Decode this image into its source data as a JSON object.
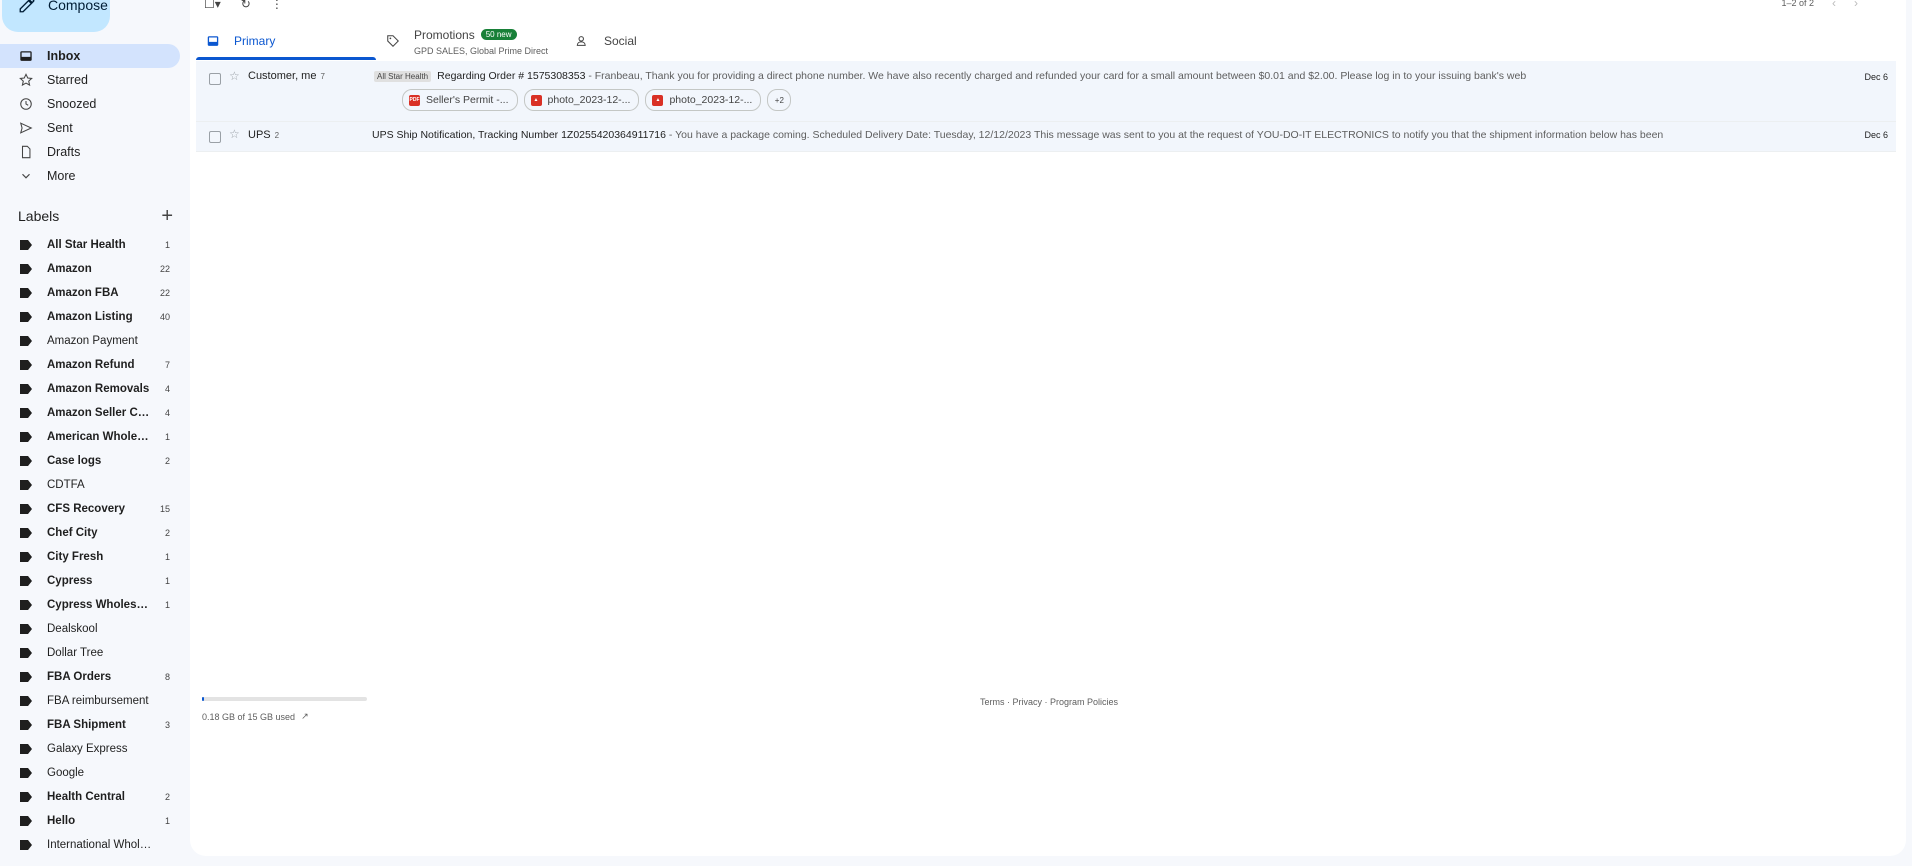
{
  "compose": {
    "label": "Compose"
  },
  "nav": [
    {
      "label": "Inbox",
      "icon": "inbox-icon",
      "active": true
    },
    {
      "label": "Starred",
      "icon": "star-icon"
    },
    {
      "label": "Snoozed",
      "icon": "clock-icon"
    },
    {
      "label": "Sent",
      "icon": "send-icon"
    },
    {
      "label": "Drafts",
      "icon": "draft-icon"
    },
    {
      "label": "More",
      "icon": "chevron-down-icon"
    }
  ],
  "labels_header": "Labels",
  "labels": [
    {
      "name": "All Star Health",
      "count": "1",
      "bold": true
    },
    {
      "name": "Amazon",
      "count": "22",
      "bold": true
    },
    {
      "name": "Amazon FBA",
      "count": "22",
      "bold": true
    },
    {
      "name": "Amazon Listing",
      "count": "40",
      "bold": true
    },
    {
      "name": "Amazon Payment",
      "count": "",
      "bold": false
    },
    {
      "name": "Amazon Refund",
      "count": "7",
      "bold": true
    },
    {
      "name": "Amazon Removals",
      "count": "4",
      "bold": true
    },
    {
      "name": "Amazon Seller Cen...",
      "count": "4",
      "bold": true
    },
    {
      "name": "American Wholesal...",
      "count": "1",
      "bold": true
    },
    {
      "name": "Case logs",
      "count": "2",
      "bold": true
    },
    {
      "name": "CDTFA",
      "count": "",
      "bold": false
    },
    {
      "name": "CFS Recovery",
      "count": "15",
      "bold": true
    },
    {
      "name": "Chef City",
      "count": "2",
      "bold": true
    },
    {
      "name": "City Fresh",
      "count": "1",
      "bold": true
    },
    {
      "name": "Cypress",
      "count": "1",
      "bold": true
    },
    {
      "name": "Cypress Wholesale",
      "count": "1",
      "bold": true
    },
    {
      "name": "Dealskool",
      "count": "",
      "bold": false
    },
    {
      "name": "Dollar Tree",
      "count": "",
      "bold": false
    },
    {
      "name": "FBA Orders",
      "count": "8",
      "bold": true
    },
    {
      "name": "FBA reimbursement",
      "count": "",
      "bold": false
    },
    {
      "name": "FBA Shipment",
      "count": "3",
      "bold": true
    },
    {
      "name": "Galaxy Express",
      "count": "",
      "bold": false
    },
    {
      "name": "Google",
      "count": "",
      "bold": false
    },
    {
      "name": "Health Central",
      "count": "2",
      "bold": true
    },
    {
      "name": "Hello",
      "count": "1",
      "bold": true
    },
    {
      "name": "International Wholesale",
      "count": "",
      "bold": false
    }
  ],
  "pager": {
    "text": "1–2 of 2"
  },
  "tabs": [
    {
      "label": "Primary",
      "icon": "inbox-tab-icon",
      "active": true
    },
    {
      "label": "Promotions",
      "icon": "tag-icon",
      "badge": "50 new",
      "sub": "GPD SALES, Global Prime Direct"
    },
    {
      "label": "Social",
      "icon": "people-icon"
    }
  ],
  "emails": [
    {
      "sender": "Customer, me",
      "count": "7",
      "label": "All Star Health",
      "subject": "Regarding Order # 1575308353",
      "snippet": " - Franbeau, Thank you for providing a direct phone number. We have also recently charged and refunded your card for a small amount between $0.01 and $2.00. Please log in to your issuing bank's web",
      "date": "Dec 6",
      "attachments": [
        "Seller's Permit -...",
        "photo_2023-12-...",
        "photo_2023-12-..."
      ],
      "more_attachments": "+2"
    },
    {
      "sender": "UPS",
      "count": "2",
      "subject": "UPS Ship Notification, Tracking Number 1Z0255420364911716",
      "snippet": " - You have a package coming. Scheduled Delivery Date: Tuesday, 12/12/2023 This message was sent to you at the request of YOU-DO-IT ELECTRONICS to notify you that the shipment information below has been",
      "date": "Dec 6"
    }
  ],
  "storage": {
    "text": "0.18 GB of 15 GB used",
    "fraction": 0.012
  },
  "footer": {
    "links": "Terms · Privacy · Program Policies"
  },
  "colors": {
    "accent": "#0b57d0",
    "compose_bg": "#c2e7ff",
    "badge": "#188038",
    "active_nav": "#d3e3fd"
  }
}
